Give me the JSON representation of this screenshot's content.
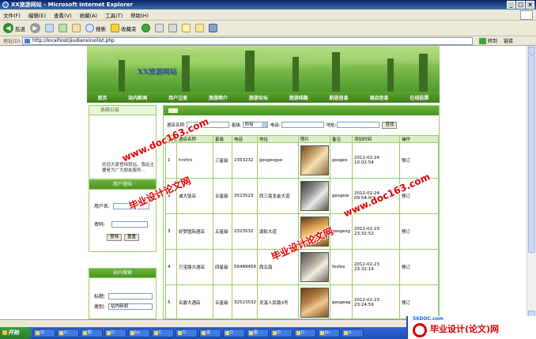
{
  "window": {
    "title": "XX旅游网站 - Microsoft Internet Explorer"
  },
  "menu": [
    "文件(F)",
    "编辑(E)",
    "查看(V)",
    "收藏(A)",
    "工具(T)",
    "帮助(H)"
  ],
  "toolbar": {
    "back": "后退",
    "search": "搜索",
    "favorites": "收藏夹"
  },
  "address": {
    "label": "地址(D)",
    "url": "http://localhost/jiudianxinxilist.php",
    "go": "转到",
    "links": "链接"
  },
  "site": {
    "title": "XX旅游网站",
    "nav": [
      "首页",
      "站内新闻",
      "用户注册",
      "旅游简介",
      "旅游论坛",
      "旅游线路",
      "航班信息",
      "酒店信息",
      "在线投票"
    ]
  },
  "sidebar": {
    "announce_title": "系统公告",
    "announce_text": "欢迎大家登陆我站，我站主要是为广大朋友服务...",
    "login_title": "用户登陆",
    "username_label": "用户名:",
    "password_label": "密码:",
    "login_btn": "登陆",
    "reset_btn": "重置",
    "search_title": "站内搜索",
    "keyword_label": "标题:",
    "type_label": "类别:",
    "type_value": "站内新闻"
  },
  "search": {
    "name_label": "酒店名称:",
    "star_label": "星级:",
    "star_value": "所有",
    "phone_label": "电话:",
    "address_label": "地址:",
    "button": "查找"
  },
  "table": {
    "headers": [
      "序号",
      "酒店名称",
      "星级",
      "电话",
      "地址",
      "照片",
      "备注",
      "添加时间",
      "操作"
    ],
    "rows": [
      {
        "no": "1",
        "name": "hrshrs",
        "star": "三星级",
        "phone": "2353232",
        "addr": "gesgesgse",
        "note": "gesges",
        "time": "2012-02-24 10:02:54",
        "op": "预订"
      },
      {
        "no": "2",
        "name": "诚大饭店",
        "star": "五星级",
        "phone": "3523523",
        "addr": "西三南龙金大道",
        "note": "gesgew",
        "time": "2012-02-24 09:54:00",
        "op": "预订"
      },
      {
        "no": "3",
        "name": "好梦国际酒店",
        "star": "五星级",
        "phone": "2323532",
        "addr": "湖影大道",
        "note": "gesgesg",
        "time": "2012-02-23 23:32:52",
        "op": "预订"
      },
      {
        "no": "4",
        "name": "万宝路大酒店",
        "star": "四星级",
        "phone": "56489456",
        "addr": "西五南",
        "note": "fesfes",
        "time": "2012-02-23 23:32:19",
        "op": "预订"
      },
      {
        "no": "5",
        "name": "名爵大酒店",
        "star": "五星级",
        "phone": "32523532",
        "addr": "灵溪人民路3号",
        "note": "gesgeag",
        "time": "2012-02-23 23:24:59",
        "op": "预订"
      }
    ]
  },
  "watermarks": {
    "site": "www.doc163.com",
    "bysj": "毕业设计论文网"
  },
  "taskbar": {
    "start": "开始",
    "tasks": [
      "ZI",
      "Li",
      "照",
      "D",
      "ku",
      "C",
      "D",
      "说",
      "D",
      "图",
      "D",
      "D",
      "jiu",
      "b"
    ]
  },
  "brand": {
    "top": "56DOC.com",
    "main": "毕业设计(论文)网"
  }
}
